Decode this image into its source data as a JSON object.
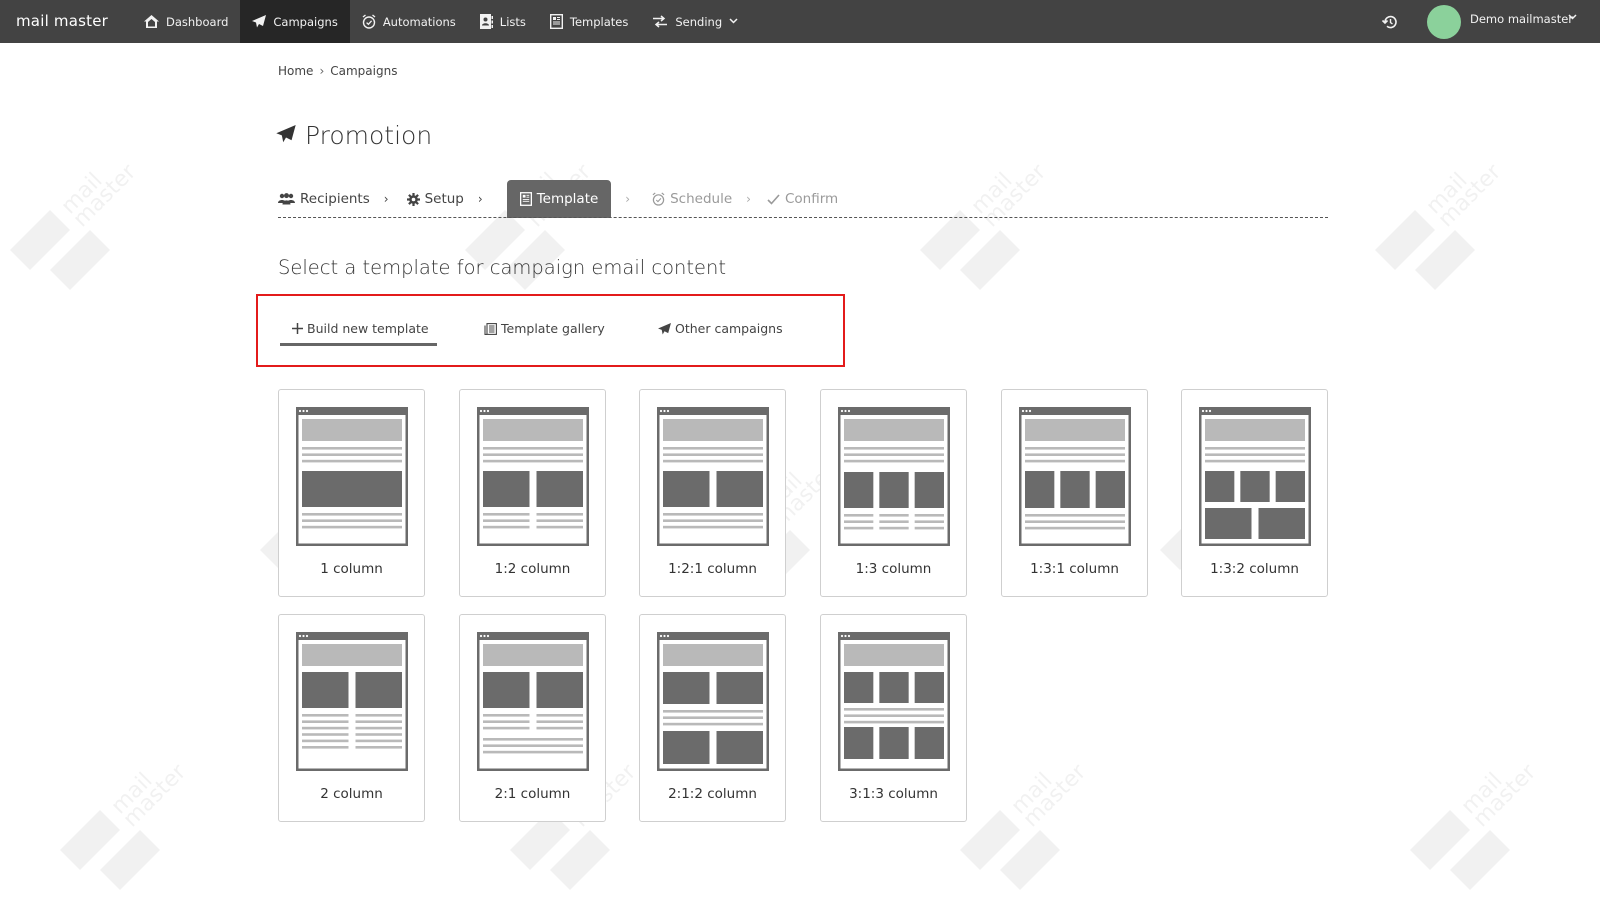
{
  "app": {
    "logo": "mail master",
    "nav": [
      {
        "label": "Dashboard",
        "icon": "home-icon",
        "active": false
      },
      {
        "label": "Campaigns",
        "icon": "paper-plane-icon",
        "active": true
      },
      {
        "label": "Automations",
        "icon": "alarm-clock-icon",
        "active": false
      },
      {
        "label": "Lists",
        "icon": "contact-book-icon",
        "active": false
      },
      {
        "label": "Templates",
        "icon": "template-icon",
        "active": false
      },
      {
        "label": "Sending",
        "icon": "swap-arrows-icon",
        "active": false,
        "has_dropdown": true
      }
    ],
    "user": {
      "name": "Demo mailmaster",
      "avatar_color": "#8bd19b"
    },
    "colors": {
      "navbar": "#434343",
      "nav_active": "#262626",
      "highlight_box": "#e31b1b"
    }
  },
  "breadcrumb": {
    "items": [
      "Home",
      "Campaigns"
    ],
    "separator": "›"
  },
  "page": {
    "title": "Promotion"
  },
  "steps": [
    {
      "label": "Recipients",
      "icon": "users-icon",
      "state": "done"
    },
    {
      "label": "Setup",
      "icon": "gear-icon",
      "state": "done"
    },
    {
      "label": "Template",
      "icon": "template-icon",
      "state": "active"
    },
    {
      "label": "Schedule",
      "icon": "alarm-clock-icon",
      "state": "disabled"
    },
    {
      "label": "Confirm",
      "icon": "check-icon",
      "state": "disabled"
    }
  ],
  "section": {
    "title": "Select a template for campaign email content"
  },
  "tabs": [
    {
      "label": "Build new template",
      "icon": "plus-icon",
      "active": true
    },
    {
      "label": "Template gallery",
      "icon": "gallery-icon",
      "active": false
    },
    {
      "label": "Other campaigns",
      "icon": "paper-plane-icon",
      "active": false
    }
  ],
  "templates": [
    {
      "label": "1 column",
      "layout": "1"
    },
    {
      "label": "1:2 column",
      "layout": "1:2"
    },
    {
      "label": "1:2:1 column",
      "layout": "1:2:1"
    },
    {
      "label": "1:3 column",
      "layout": "1:3"
    },
    {
      "label": "1:3:1 column",
      "layout": "1:3:1"
    },
    {
      "label": "1:3:2 column",
      "layout": "1:3:2"
    },
    {
      "label": "2 column",
      "layout": "2"
    },
    {
      "label": "2:1 column",
      "layout": "2:1"
    },
    {
      "label": "2:1:2 column",
      "layout": "2:1:2"
    },
    {
      "label": "3:1:3 column",
      "layout": "3:1:3"
    }
  ]
}
